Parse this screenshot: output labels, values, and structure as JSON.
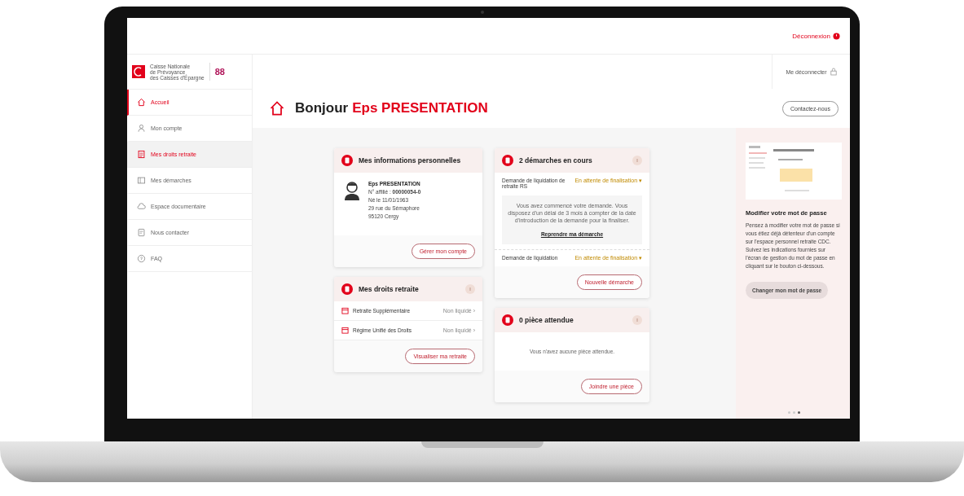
{
  "top_bar": {
    "logout": "Déconnexion"
  },
  "logo": {
    "lines": [
      "Caisse Nationale",
      "de Prévoyance",
      "des Caisses d'Épargne"
    ],
    "badge": "88"
  },
  "header": {
    "user_link": "Me déconnecter"
  },
  "sidebar": {
    "items": [
      {
        "label": "Accueil",
        "selected": true,
        "hovered": false
      },
      {
        "label": "Mon compte",
        "selected": false,
        "hovered": false
      },
      {
        "label": "Mes droits retraite",
        "selected": false,
        "hovered": true
      },
      {
        "label": "Mes démarches",
        "selected": false,
        "hovered": false
      },
      {
        "label": "Espace documentaire",
        "selected": false,
        "hovered": false
      },
      {
        "label": "Nous contacter",
        "selected": false,
        "hovered": false
      },
      {
        "label": "FAQ",
        "selected": false,
        "hovered": false
      }
    ]
  },
  "greeting": {
    "hello": "Bonjour",
    "name": "Eps PRESENTATION"
  },
  "contact_button": "Contactez-nous",
  "personal_info": {
    "title": "Mes informations personnelles",
    "name": "Eps PRESENTATION",
    "lines": [
      "N° affilié : **00000054-0**",
      "Né le 11/01/1963",
      "29 rue du Sémaphore",
      "95120 Cergy"
    ],
    "button": "Gérer mon compte"
  },
  "retirement_rights": {
    "title": "Mes droits retraite",
    "rows": [
      {
        "label": "Retraite Supplémentaire",
        "status": "Non liquidé ›"
      },
      {
        "label": "Régime Unifié des Droits",
        "status": "Non liquidé ›"
      }
    ],
    "button": "Visualiser ma retraite"
  },
  "procedures": {
    "title": "2 démarches en cours",
    "items": [
      {
        "label": "Demande de liquidation de retraite RS",
        "status": "En attente de finalisation",
        "marker": "▾",
        "expanded": true,
        "message": "Vous avez commencé votre demande. Vous disposez d'un délai de 3 mois à compter de la date d'introduction de la demande pour la finaliser.",
        "link": "Reprendre ma démarche"
      },
      {
        "label": "Demande de liquidation",
        "status": "En attente de finalisation",
        "marker": "▾",
        "expanded": false
      }
    ],
    "button": "Nouvelle démarche"
  },
  "documents": {
    "title": "0 pièce attendue",
    "message": "Vous n'avez aucune pièce attendue.",
    "button": "Joindre une pièce"
  },
  "promo": {
    "title": "Modifier votre mot de passe",
    "text": "Pensez à modifier votre mot de passe si vous étiez déjà détenteur d'un compte sur l'espace personnel retraite CDC. Suivez les indications fournies sur l'écran de gestion du mot de passe en cliquant sur le bouton ci-dessous.",
    "button": "Changer mon mot de passe",
    "slides": [
      {
        "selected": false
      },
      {
        "selected": false
      },
      {
        "selected": true
      }
    ]
  }
}
